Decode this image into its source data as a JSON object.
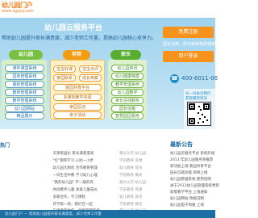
{
  "header": {
    "logo_title": "幼儿园门户",
    "logo_sub": "www.zgyey.com"
  },
  "hero": {
    "title": "幼儿园云服务平台",
    "slogan": "帮助幼儿园提升家长满意度，减少老师工作量，提高幼儿园核心竞争力。"
  },
  "columns": {
    "kindergarten": {
      "label": "幼儿园",
      "items": [
        "课件课堂系统",
        "园务管理系统",
        "晨检管理系统",
        "教师管理系统",
        "教学管理系统",
        "幼儿园网站",
        "精品展示"
      ]
    },
    "teacher": {
      "label": "老师",
      "items": [
        "宝宝好课",
        "宝宝点评",
        "家园联系",
        "成长档案",
        "家园共育平台",
        "多媒体教学资源",
        "家园互动",
        "亲子活动"
      ]
    },
    "parent": {
      "label": "家长",
      "items": [
        "幼儿园资讯",
        "幼儿健康档案",
        "教学管理系统",
        "幼儿园教学",
        "家长在线服务",
        "园长信箱",
        "智慧园区服务"
      ]
    }
  },
  "side": {
    "join_label": "免费注册",
    "join_sub": "园长注册，即可获得免费使用",
    "login_label": "用户登录",
    "phone": "400-6011-06",
    "wechat_line1": "扫一扫关注我们",
    "wechat_line2": "获取最新资讯"
  },
  "news": {
    "title": "热门",
    "items": [
      "天津某园长 家长满意度高",
      "\"红\"钢琴学习 心动一小步",
      "幼儿园大厨房 合作教育管理",
      "一日生活中教 学习幼儿心理",
      "\"我的幼儿园\" 不一般的有",
      "共同携手儿童 关爱儿童成长",
      "多家合作，学习课程",
      "开学第一周，我们在一起",
      "乐佳教育合作，创新管理系统"
    ]
  },
  "links": {
    "items": [
      "家长认可 幼儿园",
      "学前教育 资源",
      "幼儿教育 资讯",
      "学前教育 模式",
      "家长认可 幼儿园",
      "学前教育 资源",
      "幼儿教育 资讯",
      "学前教育 模式",
      "家长认可 幼儿园"
    ]
  },
  "notice": {
    "title": "最新公告",
    "items": [
      "幼儿园云服务平台 系统升级",
      "2013 年幼儿园服务商推荐",
      "新功能上线 家园共育平台",
      "园长信箱功能 即将上线",
      "幼儿园管理系统 使用说明",
      "关于2013幼儿园管理系统更新",
      "新版教学平台 上线通知",
      "幼儿园网站 改版说明",
      "幼儿园电子周报 上线"
    ]
  },
  "footer": {
    "text": "幼儿园门户 — 帮助幼儿园提升家长满意度，减少老师工作量"
  },
  "colors": {
    "orange": "#f7931d",
    "blue": "#1b6fa5",
    "green": "#7ac143",
    "yellow": "#f39c12"
  }
}
